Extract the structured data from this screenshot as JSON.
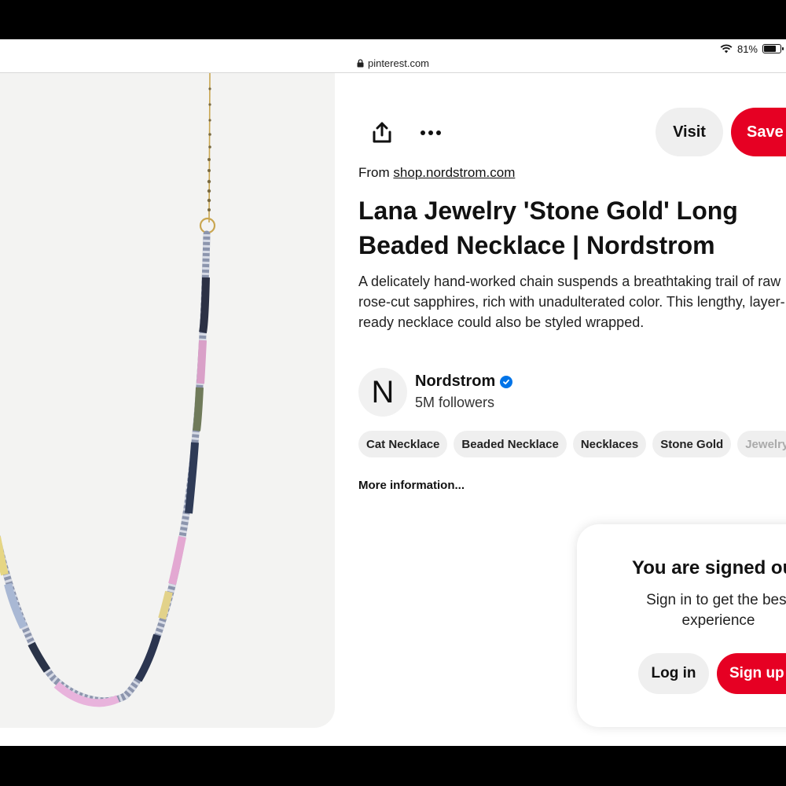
{
  "status_bar": {
    "battery_percent": "81%",
    "battery_level": 0.81,
    "wifi_icon": "wifi-icon"
  },
  "browser": {
    "url": "pinterest.com",
    "lock_icon": "lock-icon"
  },
  "actions": {
    "share_icon": "share-icon",
    "more_icon": "more-options-icon",
    "visit_label": "Visit",
    "save_label": "Save"
  },
  "pin": {
    "from_label": "From",
    "source_link": "shop.nordstrom.com",
    "title": "Lana Jewelry 'Stone Gold' Long Beaded Necklace | Nordstrom",
    "description": "A delicately hand-worked chain suspends a breathtaking trail of raw rose-cut sapphires, rich with unadulterated color. This lengthy, layer-ready necklace could also be styled wrapped."
  },
  "creator": {
    "avatar_letter": "N",
    "name": "Nordstrom",
    "followers": "5M followers",
    "verified_icon": "verified-badge-icon"
  },
  "tags": [
    "Cat Necklace",
    "Beaded Necklace",
    "Necklaces",
    "Stone Gold",
    "Jewelry"
  ],
  "more_info": "More information...",
  "signin": {
    "title": "You are signed out",
    "subtitle": "Sign in to get the best experience",
    "login_label": "Log in",
    "signup_label": "Sign up"
  },
  "colors": {
    "brand_red": "#e60023",
    "button_gray": "#efefef",
    "verified_blue": "#0074e8"
  }
}
